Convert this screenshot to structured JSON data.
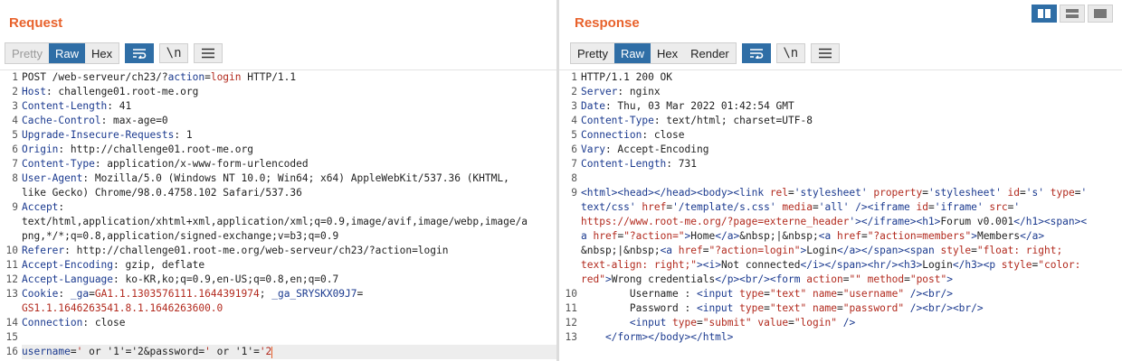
{
  "request": {
    "title": "Request",
    "tabs": [
      {
        "label": "Pretty",
        "state": "disabled"
      },
      {
        "label": "Raw",
        "state": "active"
      },
      {
        "label": "Hex",
        "state": "normal"
      }
    ],
    "icons": [
      "wrap-lines-icon",
      "newline-toggle-icon",
      "menu-icon"
    ],
    "newline_label": "\\n",
    "lines": [
      {
        "num": "1",
        "parts": [
          {
            "t": "POST /web-serveur/ch23/?",
            "c": "v"
          },
          {
            "t": "action",
            "c": "k"
          },
          {
            "t": "=",
            "c": "v"
          },
          {
            "t": "login",
            "c": "red"
          },
          {
            "t": " HTTP/1.1",
            "c": "v"
          }
        ]
      },
      {
        "num": "2",
        "parts": [
          {
            "t": "Host",
            "c": "k"
          },
          {
            "t": ": challenge01.root-me.org",
            "c": "v"
          }
        ]
      },
      {
        "num": "3",
        "parts": [
          {
            "t": "Content-Length",
            "c": "k"
          },
          {
            "t": ": 41",
            "c": "v"
          }
        ]
      },
      {
        "num": "4",
        "parts": [
          {
            "t": "Cache-Control",
            "c": "k"
          },
          {
            "t": ": max-age=0",
            "c": "v"
          }
        ]
      },
      {
        "num": "5",
        "parts": [
          {
            "t": "Upgrade-Insecure-Requests",
            "c": "k"
          },
          {
            "t": ": 1",
            "c": "v"
          }
        ]
      },
      {
        "num": "6",
        "parts": [
          {
            "t": "Origin",
            "c": "k"
          },
          {
            "t": ": http://challenge01.root-me.org",
            "c": "v"
          }
        ]
      },
      {
        "num": "7",
        "parts": [
          {
            "t": "Content-Type",
            "c": "k"
          },
          {
            "t": ": application/x-www-form-urlencoded",
            "c": "v"
          }
        ]
      },
      {
        "num": "8",
        "parts": [
          {
            "t": "User-Agent",
            "c": "k"
          },
          {
            "t": ": Mozilla/5.0 (Windows NT 10.0; Win64; x64) AppleWebKit/537.36 (KHTML,",
            "c": "v"
          }
        ]
      },
      {
        "num": "",
        "parts": [
          {
            "t": "like Gecko) Chrome/98.0.4758.102 Safari/537.36",
            "c": "v"
          }
        ]
      },
      {
        "num": "9",
        "parts": [
          {
            "t": "Accept",
            "c": "k"
          },
          {
            "t": ":",
            "c": "v"
          }
        ]
      },
      {
        "num": "",
        "parts": [
          {
            "t": "text/html,application/xhtml+xml,application/xml;q=0.9,image/avif,image/webp,image/a",
            "c": "v"
          }
        ]
      },
      {
        "num": "",
        "parts": [
          {
            "t": "png,*/*;q=0.8,application/signed-exchange;v=b3;q=0.9",
            "c": "v"
          }
        ]
      },
      {
        "num": "10",
        "parts": [
          {
            "t": "Referer",
            "c": "k"
          },
          {
            "t": ": http://challenge01.root-me.org/web-serveur/ch23/?action=login",
            "c": "v"
          }
        ]
      },
      {
        "num": "11",
        "parts": [
          {
            "t": "Accept-Encoding",
            "c": "k"
          },
          {
            "t": ": gzip, deflate",
            "c": "v"
          }
        ]
      },
      {
        "num": "12",
        "parts": [
          {
            "t": "Accept-Language",
            "c": "k"
          },
          {
            "t": ": ko-KR,ko;q=0.9,en-US;q=0.8,en;q=0.7",
            "c": "v"
          }
        ]
      },
      {
        "num": "13",
        "parts": [
          {
            "t": "Cookie",
            "c": "k"
          },
          {
            "t": ": ",
            "c": "v"
          },
          {
            "t": "_ga",
            "c": "k"
          },
          {
            "t": "=",
            "c": "v"
          },
          {
            "t": "GA1.1.1303576111.1644391974",
            "c": "red"
          },
          {
            "t": "; ",
            "c": "v"
          },
          {
            "t": "_ga_SRYSKX09J7",
            "c": "k"
          },
          {
            "t": "=",
            "c": "v"
          }
        ]
      },
      {
        "num": "",
        "parts": [
          {
            "t": "GS1.1.1646263541.8.1.1646263600.0",
            "c": "red"
          }
        ]
      },
      {
        "num": "14",
        "parts": [
          {
            "t": "Connection",
            "c": "k"
          },
          {
            "t": ": close",
            "c": "v"
          }
        ]
      },
      {
        "num": "15",
        "parts": []
      },
      {
        "num": "16",
        "hl": true,
        "caret": true,
        "parts": [
          {
            "t": "username",
            "c": "k"
          },
          {
            "t": "=",
            "c": "v"
          },
          {
            "t": "'",
            "c": "red"
          },
          {
            "t": " or ",
            "c": "v"
          },
          {
            "t": "'1'",
            "c": "v"
          },
          {
            "t": "=",
            "c": "v"
          },
          {
            "t": "'2&password=",
            "c": "v"
          },
          {
            "t": "'",
            "c": "red"
          },
          {
            "t": " or ",
            "c": "v"
          },
          {
            "t": "'1'",
            "c": "v"
          },
          {
            "t": "=",
            "c": "v"
          },
          {
            "t": "'2",
            "c": "red"
          }
        ]
      }
    ]
  },
  "response": {
    "title": "Response",
    "tabs": [
      {
        "label": "Pretty",
        "state": "normal"
      },
      {
        "label": "Raw",
        "state": "active"
      },
      {
        "label": "Hex",
        "state": "normal"
      },
      {
        "label": "Render",
        "state": "normal"
      }
    ],
    "icons": [
      "wrap-lines-icon",
      "newline-toggle-icon",
      "menu-icon"
    ],
    "newline_label": "\\n",
    "lines": [
      {
        "num": "1",
        "parts": [
          {
            "t": "HTTP/1.1 200 OK",
            "c": "v"
          }
        ]
      },
      {
        "num": "2",
        "parts": [
          {
            "t": "Server",
            "c": "k"
          },
          {
            "t": ": nginx",
            "c": "v"
          }
        ]
      },
      {
        "num": "3",
        "parts": [
          {
            "t": "Date",
            "c": "k"
          },
          {
            "t": ": Thu, 03 Mar 2022 01:42:54 GMT",
            "c": "v"
          }
        ]
      },
      {
        "num": "4",
        "parts": [
          {
            "t": "Content-Type",
            "c": "k"
          },
          {
            "t": ": text/html; charset=UTF-8",
            "c": "v"
          }
        ]
      },
      {
        "num": "5",
        "parts": [
          {
            "t": "Connection",
            "c": "k"
          },
          {
            "t": ": close",
            "c": "v"
          }
        ]
      },
      {
        "num": "6",
        "parts": [
          {
            "t": "Vary",
            "c": "k"
          },
          {
            "t": ": Accept-Encoding",
            "c": "v"
          }
        ]
      },
      {
        "num": "7",
        "parts": [
          {
            "t": "Content-Length",
            "c": "k"
          },
          {
            "t": ": 731",
            "c": "v"
          }
        ]
      },
      {
        "num": "8",
        "parts": []
      },
      {
        "num": "9",
        "parts": [
          {
            "t": "<html><head></head><body><link ",
            "c": "tag"
          },
          {
            "t": "rel",
            "c": "attr"
          },
          {
            "t": "=",
            "c": "v"
          },
          {
            "t": "'stylesheet' ",
            "c": "tag"
          },
          {
            "t": "property",
            "c": "attr"
          },
          {
            "t": "=",
            "c": "v"
          },
          {
            "t": "'stylesheet' ",
            "c": "tag"
          },
          {
            "t": "id",
            "c": "attr"
          },
          {
            "t": "=",
            "c": "v"
          },
          {
            "t": "'s' ",
            "c": "tag"
          },
          {
            "t": "type",
            "c": "attr"
          },
          {
            "t": "=",
            "c": "v"
          },
          {
            "t": "'",
            "c": "tag"
          }
        ]
      },
      {
        "num": "",
        "parts": [
          {
            "t": "text/css' ",
            "c": "tag"
          },
          {
            "t": "href",
            "c": "attr"
          },
          {
            "t": "=",
            "c": "v"
          },
          {
            "t": "'/template/s.css' ",
            "c": "tag"
          },
          {
            "t": "media",
            "c": "attr"
          },
          {
            "t": "=",
            "c": "v"
          },
          {
            "t": "'all' ",
            "c": "tag"
          },
          {
            "t": "/><iframe ",
            "c": "tag"
          },
          {
            "t": "id",
            "c": "attr"
          },
          {
            "t": "=",
            "c": "v"
          },
          {
            "t": "'iframe' ",
            "c": "tag"
          },
          {
            "t": "src",
            "c": "attr"
          },
          {
            "t": "=",
            "c": "v"
          },
          {
            "t": "'",
            "c": "tag"
          }
        ]
      },
      {
        "num": "",
        "parts": [
          {
            "t": "https://www.root-me.org/?page=externe_header",
            "c": "red"
          },
          {
            "t": "'></iframe><h1>",
            "c": "tag"
          },
          {
            "t": "Forum v0.001",
            "c": "v"
          },
          {
            "t": "</h1><span><",
            "c": "tag"
          }
        ]
      },
      {
        "num": "",
        "parts": [
          {
            "t": "a ",
            "c": "tag"
          },
          {
            "t": "href",
            "c": "attr"
          },
          {
            "t": "=",
            "c": "v"
          },
          {
            "t": "\"?action=\"",
            "c": "red"
          },
          {
            "t": ">",
            "c": "tag"
          },
          {
            "t": "Home",
            "c": "v"
          },
          {
            "t": "</a>",
            "c": "tag"
          },
          {
            "t": "&nbsp;|&nbsp;",
            "c": "v"
          },
          {
            "t": "<a ",
            "c": "tag"
          },
          {
            "t": "href",
            "c": "attr"
          },
          {
            "t": "=",
            "c": "v"
          },
          {
            "t": "\"?action=members\"",
            "c": "red"
          },
          {
            "t": ">",
            "c": "tag"
          },
          {
            "t": "Members",
            "c": "v"
          },
          {
            "t": "</a>",
            "c": "tag"
          }
        ]
      },
      {
        "num": "",
        "parts": [
          {
            "t": "&nbsp;|&nbsp;",
            "c": "v"
          },
          {
            "t": "<a ",
            "c": "tag"
          },
          {
            "t": "href",
            "c": "attr"
          },
          {
            "t": "=",
            "c": "v"
          },
          {
            "t": "\"?action=login\"",
            "c": "red"
          },
          {
            "t": ">",
            "c": "tag"
          },
          {
            "t": "Login",
            "c": "v"
          },
          {
            "t": "</a></span><span ",
            "c": "tag"
          },
          {
            "t": "style",
            "c": "attr"
          },
          {
            "t": "=",
            "c": "v"
          },
          {
            "t": "\"float: right;",
            "c": "red"
          }
        ]
      },
      {
        "num": "",
        "parts": [
          {
            "t": "text-align: right;\"",
            "c": "red"
          },
          {
            "t": "><i>",
            "c": "tag"
          },
          {
            "t": "Not connected",
            "c": "v"
          },
          {
            "t": "</i></span><hr/><h3>",
            "c": "tag"
          },
          {
            "t": "Login",
            "c": "v"
          },
          {
            "t": "</h3><p ",
            "c": "tag"
          },
          {
            "t": "style",
            "c": "attr"
          },
          {
            "t": "=",
            "c": "v"
          },
          {
            "t": "\"color:",
            "c": "red"
          }
        ]
      },
      {
        "num": "",
        "parts": [
          {
            "t": "red\"",
            "c": "red"
          },
          {
            "t": ">",
            "c": "tag"
          },
          {
            "t": "Wrong credentials",
            "c": "v"
          },
          {
            "t": "</p><br/><form ",
            "c": "tag"
          },
          {
            "t": "action",
            "c": "attr"
          },
          {
            "t": "=",
            "c": "v"
          },
          {
            "t": "\"\" ",
            "c": "red"
          },
          {
            "t": "method",
            "c": "attr"
          },
          {
            "t": "=",
            "c": "v"
          },
          {
            "t": "\"post\"",
            "c": "red"
          },
          {
            "t": ">",
            "c": "tag"
          }
        ]
      },
      {
        "num": "10",
        "parts": [
          {
            "t": "        Username : ",
            "c": "v"
          },
          {
            "t": "<input ",
            "c": "tag"
          },
          {
            "t": "type",
            "c": "attr"
          },
          {
            "t": "=",
            "c": "v"
          },
          {
            "t": "\"text\" ",
            "c": "red"
          },
          {
            "t": "name",
            "c": "attr"
          },
          {
            "t": "=",
            "c": "v"
          },
          {
            "t": "\"username\" ",
            "c": "red"
          },
          {
            "t": "/><br/>",
            "c": "tag"
          }
        ]
      },
      {
        "num": "11",
        "parts": [
          {
            "t": "        Password : ",
            "c": "v"
          },
          {
            "t": "<input ",
            "c": "tag"
          },
          {
            "t": "type",
            "c": "attr"
          },
          {
            "t": "=",
            "c": "v"
          },
          {
            "t": "\"text\" ",
            "c": "red"
          },
          {
            "t": "name",
            "c": "attr"
          },
          {
            "t": "=",
            "c": "v"
          },
          {
            "t": "\"password\" ",
            "c": "red"
          },
          {
            "t": "/><br/><br/>",
            "c": "tag"
          }
        ]
      },
      {
        "num": "12",
        "parts": [
          {
            "t": "        ",
            "c": "v"
          },
          {
            "t": "<input ",
            "c": "tag"
          },
          {
            "t": "type",
            "c": "attr"
          },
          {
            "t": "=",
            "c": "v"
          },
          {
            "t": "\"submit\" ",
            "c": "red"
          },
          {
            "t": "value",
            "c": "attr"
          },
          {
            "t": "=",
            "c": "v"
          },
          {
            "t": "\"login\" ",
            "c": "red"
          },
          {
            "t": "/>",
            "c": "tag"
          }
        ]
      },
      {
        "num": "13",
        "parts": [
          {
            "t": "    </form></body></html>",
            "c": "tag"
          }
        ]
      }
    ]
  },
  "layout_buttons": [
    {
      "name": "side-by-side-layout-icon",
      "active": true
    },
    {
      "name": "stacked-layout-icon",
      "active": false
    },
    {
      "name": "single-pane-layout-icon",
      "active": false
    }
  ],
  "colors": {
    "accent": "#e8622c",
    "active_tab": "#2f6ea6",
    "key": "#1b3a8f",
    "value_red": "#b22a1e"
  }
}
